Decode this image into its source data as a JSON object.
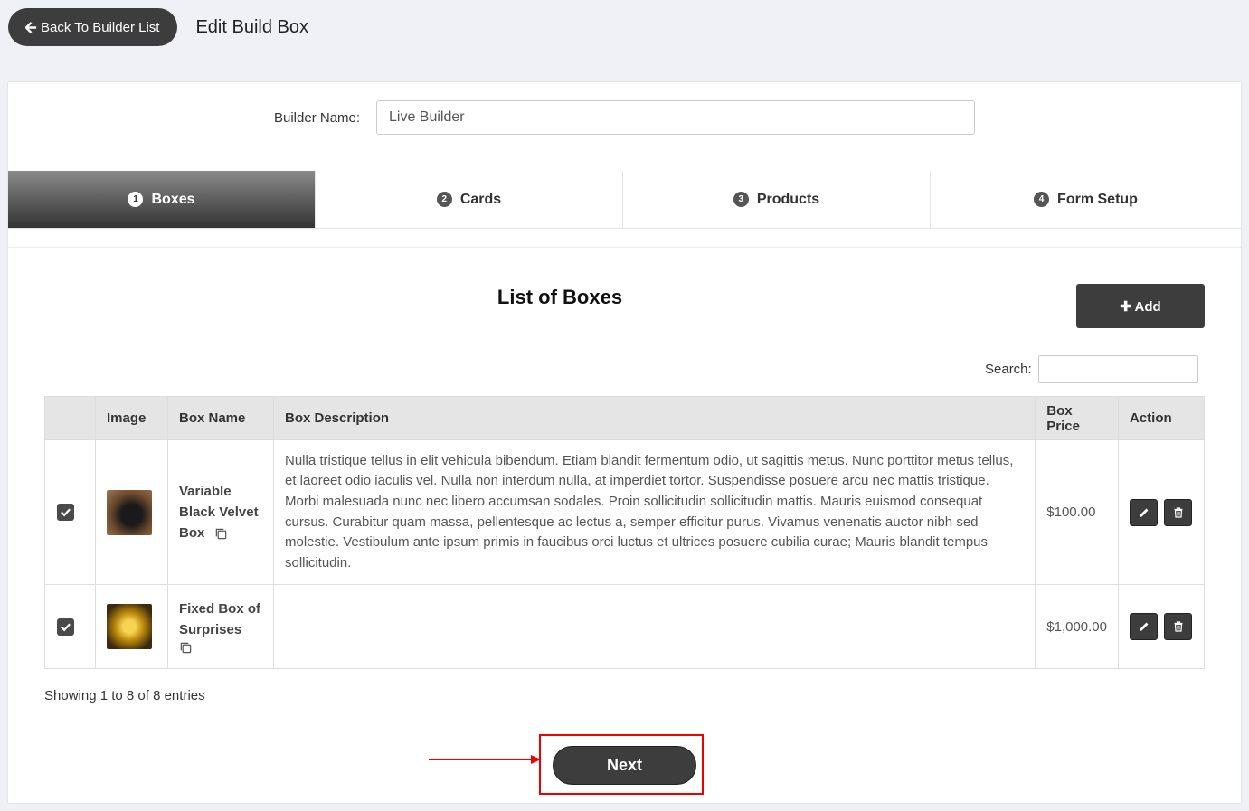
{
  "header": {
    "back_label": "Back To Builder List",
    "title": "Edit Build Box"
  },
  "builder": {
    "label": "Builder Name:",
    "value": "Live Builder"
  },
  "tabs": [
    {
      "num": "1",
      "label": "Boxes",
      "active": true
    },
    {
      "num": "2",
      "label": "Cards",
      "active": false
    },
    {
      "num": "3",
      "label": "Products",
      "active": false
    },
    {
      "num": "4",
      "label": "Form Setup",
      "active": false
    }
  ],
  "list": {
    "title": "List of Boxes",
    "add_label": "Add",
    "search_label": "Search:"
  },
  "table": {
    "columns": [
      "",
      "Image",
      "Box Name",
      "Box Description",
      "Box Price",
      "Action"
    ],
    "rows": [
      {
        "checked": true,
        "name": "Variable Black Velvet Box",
        "description": "Nulla tristique tellus in elit vehicula bibendum. Etiam blandit fermentum odio, ut sagittis metus. Nunc porttitor metus tellus, et laoreet odio iaculis vel. Nulla non interdum nulla, at imperdiet tortor. Suspendisse posuere arcu nec mattis tristique. Morbi malesuada nunc nec libero accumsan sodales. Proin sollicitudin sollicitudin mattis. Mauris euismod consequat cursus. Curabitur quam massa, pellentesque ac lectus a, semper efficitur purus. Vivamus venenatis auctor nibh sed molestie. Vestibulum ante ipsum primis in faucibus orci luctus et ultrices posuere cubilia curae; Mauris blandit tempus sollicitudin.",
        "price": "$100.00"
      },
      {
        "checked": true,
        "name": "Fixed Box of Surprises",
        "description": "",
        "price": "$1,000.00"
      }
    ]
  },
  "footer": {
    "entries": "Showing 1 to 8 of 8 entries",
    "next_label": "Next"
  },
  "colors": {
    "dark_button": "#3d3d3d",
    "highlight": "#e00000",
    "background": "#f0f0f7"
  }
}
